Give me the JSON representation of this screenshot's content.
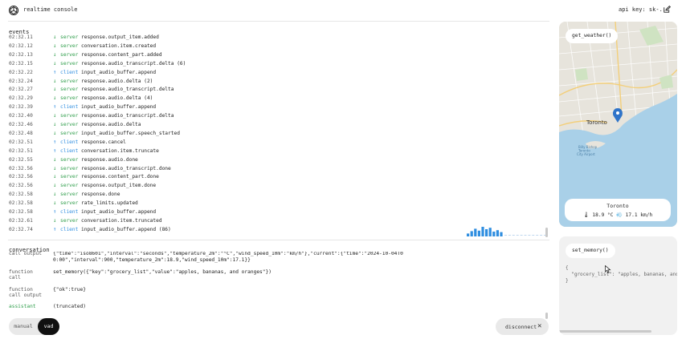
{
  "header": {
    "title": "realtime console",
    "api_key_label": "api key: sk-..."
  },
  "events": {
    "title": "events",
    "items": [
      {
        "time": "02:32.11",
        "source": "server",
        "type": "response.output_item.added"
      },
      {
        "time": "02:32.12",
        "source": "server",
        "type": "conversation.item.created"
      },
      {
        "time": "02:32.13",
        "source": "server",
        "type": "response.content_part.added"
      },
      {
        "time": "02:32.15",
        "source": "server",
        "type": "response.audio_transcript.delta (6)"
      },
      {
        "time": "02:32.22",
        "source": "client",
        "type": "input_audio_buffer.append"
      },
      {
        "time": "02:32.24",
        "source": "server",
        "type": "response.audio.delta (2)"
      },
      {
        "time": "02:32.27",
        "source": "server",
        "type": "response.audio_transcript.delta"
      },
      {
        "time": "02:32.29",
        "source": "server",
        "type": "response.audio.delta (4)"
      },
      {
        "time": "02:32.39",
        "source": "client",
        "type": "input_audio_buffer.append"
      },
      {
        "time": "02:32.40",
        "source": "server",
        "type": "response.audio_transcript.delta"
      },
      {
        "time": "02:32.46",
        "source": "server",
        "type": "response.audio.delta"
      },
      {
        "time": "02:32.48",
        "source": "server",
        "type": "input_audio_buffer.speech_started"
      },
      {
        "time": "02:32.51",
        "source": "client",
        "type": "response.cancel"
      },
      {
        "time": "02:32.51",
        "source": "client",
        "type": "conversation.item.truncate"
      },
      {
        "time": "02:32.55",
        "source": "server",
        "type": "response.audio.done"
      },
      {
        "time": "02:32.56",
        "source": "server",
        "type": "response.audio_transcript.done"
      },
      {
        "time": "02:32.56",
        "source": "server",
        "type": "response.content_part.done"
      },
      {
        "time": "02:32.56",
        "source": "server",
        "type": "response.output_item.done"
      },
      {
        "time": "02:32.58",
        "source": "server",
        "type": "response.done"
      },
      {
        "time": "02:32.58",
        "source": "server",
        "type": "rate_limits.updated"
      },
      {
        "time": "02:32.58",
        "source": "client",
        "type": "input_audio_buffer.append"
      },
      {
        "time": "02:32.61",
        "source": "server",
        "type": "conversation.item.truncated"
      },
      {
        "time": "02:32.74",
        "source": "client",
        "type": "input_audio_buffer.append (86)"
      }
    ],
    "audio_levels": [
      0.3,
      0.55,
      0.8,
      0.6,
      1.0,
      0.75,
      0.9,
      0.5,
      0.65,
      0.45
    ]
  },
  "conversation": {
    "title": "conversation",
    "items": [
      {
        "role": "call output",
        "content": "{\"time\":\"iso8601\",\"interval\":\"seconds\",\"temperature_2m\":\"°C\",\"wind_speed_10m\":\"km/h\"},\"current\":{\"time\":\"2024-10-04T00:00\",\"interval\":900,\"temperature_2m\":18.9,\"wind_speed_10m\":17.1}}"
      },
      {
        "role": "function\ncall",
        "content": "set_memory({\"key\":\"grocery_list\",\"value\":\"apples, bananas, and oranges\"})"
      },
      {
        "role": "function\ncall output",
        "content": "{\"ok\":true}"
      },
      {
        "role": "assistant",
        "content": "(truncated)"
      }
    ]
  },
  "controls": {
    "mode_manual": "manual",
    "mode_vad": "vad",
    "disconnect": "disconnect"
  },
  "weather": {
    "function_label": "get_weather()",
    "city": "Toronto",
    "readout": "🌡 18.9 °C 💨 17.1 km/h",
    "map_labels": {
      "toronto": "Toronto",
      "billy": "Billy Bishop\nToronto\nCity Airport"
    }
  },
  "memory": {
    "function_label": "set_memory()",
    "json_text": "{\n  \"grocery_list\": \"apples, bananas, and\n}"
  },
  "colors": {
    "server": "#2e9d4a",
    "client": "#2f8ee0",
    "bars": "#2f8ee0"
  }
}
